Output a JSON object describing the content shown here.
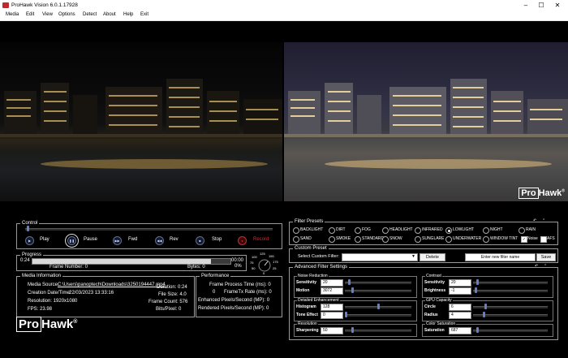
{
  "window": {
    "title": "ProHawk Vision 6.0.1.17928",
    "minimize_icon": "minimize-icon",
    "maximize_icon": "maximize-icon",
    "close_icon": "close-icon"
  },
  "menu": [
    "Media",
    "Edit",
    "View",
    "Options",
    "Detect",
    "About",
    "Help",
    "Exit"
  ],
  "control": {
    "title": "Control",
    "buttons": [
      {
        "label": "Play",
        "icon": "play-icon"
      },
      {
        "label": "Pause",
        "icon": "pause-icon"
      },
      {
        "label": "Fwd",
        "icon": "forward-icon"
      },
      {
        "label": "Rev",
        "icon": "rewind-icon"
      },
      {
        "label": "Stop",
        "icon": "stop-icon"
      },
      {
        "label": "Record",
        "icon": "record-icon"
      }
    ],
    "record_color": "#d0282d"
  },
  "progress": {
    "title": "Progress",
    "time_start": "0:24",
    "time_end": "00:00",
    "percent": "0%",
    "frame_number": "Frame Number: 0",
    "bytes": "Bytes: 0",
    "fill": 0.9,
    "gauge_labels": [
      "125",
      "150",
      "100",
      "175",
      "75",
      "50",
      "25",
      "0"
    ]
  },
  "media_info": {
    "title": "Media Information",
    "source_label": "Media Source:",
    "source": "C:\\Users\\panoptech\\Downloads\\3250194447.mp4",
    "creation_label": "Creation Date/Time:",
    "creation": "22/03/2023 13:33:16",
    "resolution": "Resolution: 1920x1080",
    "fps": "FPS: 23.98",
    "duration": "Duration: 0:24",
    "file_size": "File Size: 4.0",
    "frame_count": "Frame Count: 576",
    "bits_pixel": "Bits/Pixel: 0"
  },
  "performance": {
    "title": "Performance",
    "process_time": "Frame Process Time (ms): 0",
    "tx_rate_label": "FrameTx Rate (ms): 0",
    "tx_rate_prefix": "0",
    "enhanced": "Enhanced Pixels/Second (MP): 0",
    "rendered": "Rendered Pixels/Second (MP): 0"
  },
  "logo": {
    "text_pro": "Pro",
    "text_hawk": "Hawk",
    "mark": "®"
  },
  "filter_presets": {
    "title": "Filter Presets",
    "options_row1": [
      "BACKLIGHT",
      "DIRT",
      "FOG",
      "HEADLIGHT",
      "INFRARED",
      "LOWLIGHT",
      "NIGHT",
      "RAIN"
    ],
    "options_row2": [
      "SAND",
      "SMOKE",
      "STANDARD",
      "SNOW",
      "SUNGLARE",
      "UNDERWATER",
      "WINDOW TINT"
    ],
    "selected": "LOWLIGHT",
    "noise_label": "Noise",
    "noise_checked": true,
    "afs_label": "AFS",
    "afs_checked": false
  },
  "custom_preset": {
    "title": "Custom Preset",
    "select_label": "Select Custom Filter:",
    "delete_label": "Delete",
    "name_placeholder": "Enter new filter name",
    "save_label": "Save"
  },
  "advanced": {
    "title": "Advanced Filter Settings",
    "noise_reduction": {
      "title": "Noise Reduction",
      "sensitivity_label": "Sensitivity",
      "sensitivity": "20",
      "motion_label": "Motion",
      "motion": "3072"
    },
    "contrast": {
      "title": "Contrast",
      "sensitivity_label": "Sensitivity",
      "sensitivity": "20",
      "brightness_label": "Brightness",
      "brightness": "-1"
    },
    "detailed": {
      "title": "Detailed Enhancement",
      "histogram_label": "Histogram",
      "histogram": "128",
      "tone_label": "Tone Effect",
      "tone": "0"
    },
    "gpu": {
      "title": "GPU Capacity",
      "circle_label": "Circle",
      "circle": "6",
      "radius_label": "Radius",
      "radius": "4"
    },
    "resolution": {
      "title": "Resolution",
      "sharpening_label": "Sharpening",
      "sharpening": "50"
    },
    "color_saturation": {
      "title": "Color Saturation",
      "saturation_label": "Saturation",
      "saturation": "687"
    }
  }
}
